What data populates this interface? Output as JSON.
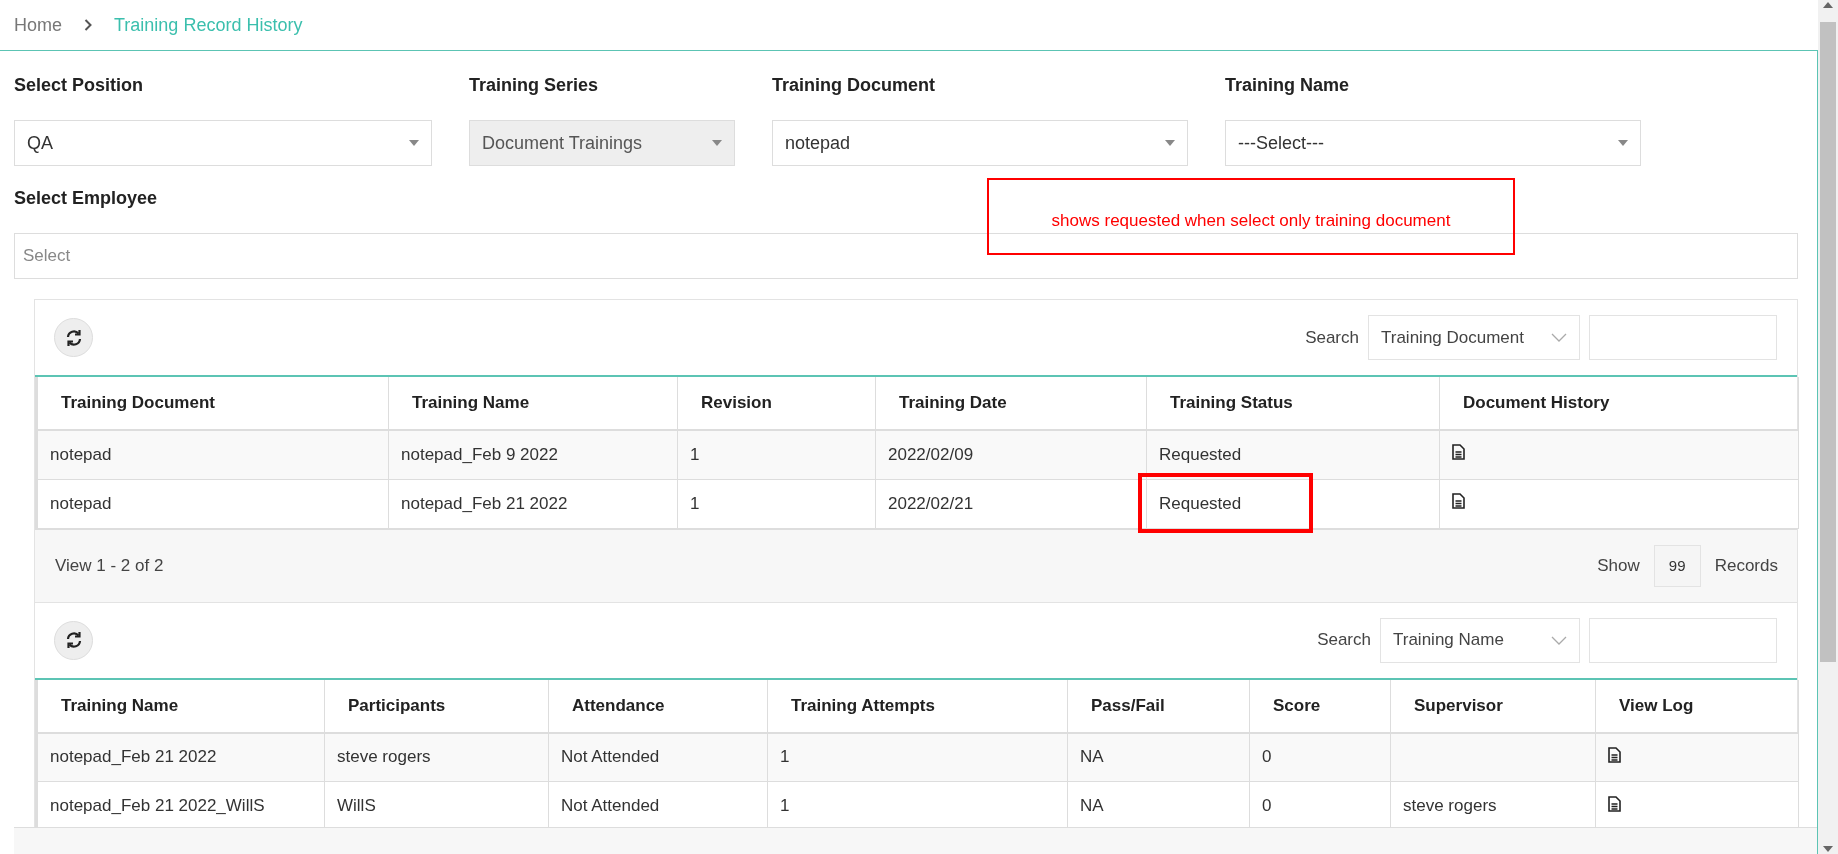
{
  "breadcrumb": {
    "home": "Home",
    "current": "Training Record History"
  },
  "filters": [
    {
      "label": "Select Position",
      "value": "QA",
      "disabled": false
    },
    {
      "label": "Training Series",
      "value": "Document Trainings",
      "disabled": true
    },
    {
      "label": "Training Document",
      "value": "notepad",
      "disabled": false
    },
    {
      "label": "Training Name",
      "value": "---Select---",
      "disabled": false
    }
  ],
  "employee": {
    "label": "Select Employee",
    "placeholder": "Select"
  },
  "annotation": {
    "text": "shows requested when select only training document"
  },
  "tables": [
    {
      "search": {
        "label": "Search",
        "field": "Training Document"
      },
      "columns": [
        "Training Document",
        "Training Name",
        "Revision",
        "Training Date",
        "Training Status",
        "Document History"
      ],
      "rows": [
        {
          "cells": [
            {
              "kind": "text",
              "text": "notepad",
              "highlighted": false
            },
            {
              "kind": "text",
              "text": "notepad_Feb 9 2022",
              "highlighted": false
            },
            {
              "kind": "text",
              "text": "1",
              "highlighted": false
            },
            {
              "kind": "text",
              "text": "2022/02/09",
              "highlighted": false
            },
            {
              "kind": "text",
              "text": "Requested",
              "highlighted": false
            },
            {
              "kind": "icon",
              "highlighted": false
            }
          ]
        },
        {
          "cells": [
            {
              "kind": "text",
              "text": "notepad",
              "highlighted": false
            },
            {
              "kind": "text",
              "text": "notepad_Feb 21 2022",
              "highlighted": false
            },
            {
              "kind": "text",
              "text": "1",
              "highlighted": false
            },
            {
              "kind": "text",
              "text": "2022/02/21",
              "highlighted": false
            },
            {
              "kind": "text",
              "text": "Requested",
              "highlighted": true
            },
            {
              "kind": "icon",
              "highlighted": false
            }
          ]
        }
      ],
      "footer": {
        "view": "View 1 - 2 of 2",
        "show": "Show",
        "count": "99",
        "records": "Records"
      }
    },
    {
      "search": {
        "label": "Search",
        "field": "Training Name"
      },
      "columns": [
        "Training Name",
        "Participants",
        "Attendance",
        "Training Attempts",
        "Pass/Fail",
        "Score",
        "Supervisor",
        "View Log"
      ],
      "rows": [
        {
          "cells": [
            {
              "kind": "text",
              "text": "notepad_Feb 21 2022"
            },
            {
              "kind": "text",
              "text": "steve rogers"
            },
            {
              "kind": "text",
              "text": "Not Attended"
            },
            {
              "kind": "text",
              "text": "1"
            },
            {
              "kind": "text",
              "text": "NA"
            },
            {
              "kind": "text",
              "text": "0"
            },
            {
              "kind": "blank"
            },
            {
              "kind": "icon"
            }
          ]
        },
        {
          "cells": [
            {
              "kind": "text",
              "text": "notepad_Feb 21 2022_WillS"
            },
            {
              "kind": "text",
              "text": "WillS"
            },
            {
              "kind": "text",
              "text": "Not Attended"
            },
            {
              "kind": "text",
              "text": "1"
            },
            {
              "kind": "text",
              "text": "NA"
            },
            {
              "kind": "text",
              "text": "0"
            },
            {
              "kind": "text",
              "text": "steve rogers"
            },
            {
              "kind": "icon"
            }
          ]
        }
      ]
    }
  ]
}
